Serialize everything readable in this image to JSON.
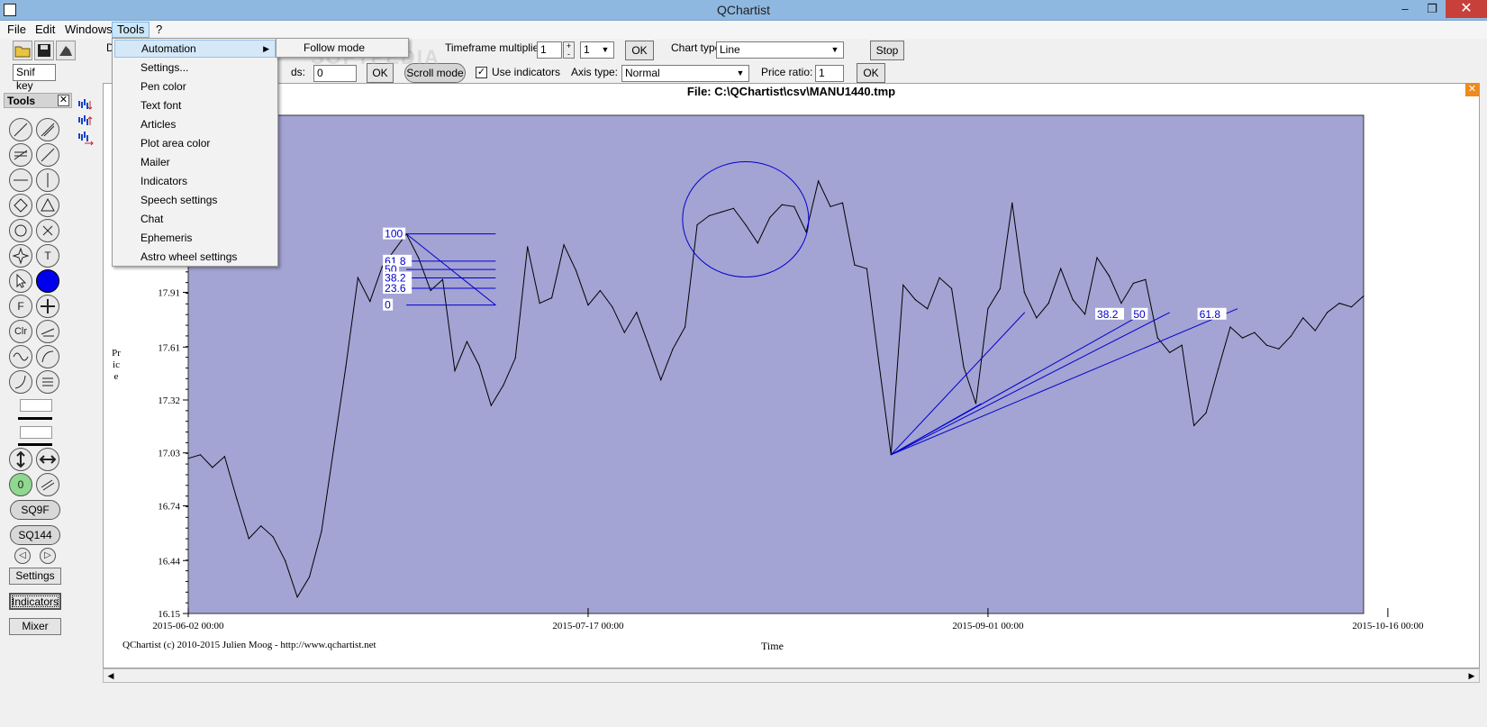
{
  "window": {
    "title": "QChartist",
    "minimize": "–",
    "maximize": "❐",
    "close": "✕"
  },
  "menubar": [
    "File",
    "Edit",
    "Windows",
    "Tools",
    "?"
  ],
  "toolbar": {
    "snif_key_value": "Snif key",
    "row1_prefix": "D",
    "row2_prefix": "0",
    "timeframe_label": "Timeframe multiplier:",
    "timeframe_value": "1",
    "stepper_plus": "+",
    "stepper_minus": "-",
    "timeframe_select": "1",
    "ok": "OK",
    "chart_type_label": "Chart type:",
    "chart_type_value": "Line",
    "stop": "Stop",
    "ds_label": "ds:",
    "ds_value": "0",
    "scroll_mode": "Scroll mode",
    "use_indicators_label": "Use indicators",
    "use_indicators_checked": "✓",
    "axis_type_label": "Axis type:",
    "axis_type_value": "Normal",
    "price_ratio_label": "Price ratio:",
    "price_ratio_value": "1"
  },
  "tools_panel": {
    "title": "Tools",
    "close": "✕",
    "labels": {
      "text": "T",
      "fib": "F",
      "clr": "Clr",
      "zero": "0"
    },
    "sq9f": "SQ9F",
    "sq144": "SQ144",
    "settings": "Settings",
    "indicators": "Indicators",
    "mixer": "Mixer"
  },
  "tools_menu": {
    "items": [
      "Automation",
      "Settings...",
      "Pen color",
      "Text font",
      "Articles",
      "Plot area color",
      "Mailer",
      "Indicators",
      "Speech settings",
      "Chat",
      "Ephemeris",
      "Astro wheel settings"
    ],
    "submenu": [
      "Follow mode"
    ]
  },
  "chart": {
    "file_title": "File: C:\\QChartist\\csv\\MANU1440.tmp",
    "copyright": "QChartist (c) 2010-2015 Julien Moog - http://www.qchartist.net",
    "watermark": "SOFTPEDIA",
    "colors": {
      "plot_bg": "#a3a3d4",
      "price_line": "#000000",
      "drawing": "#0000cc"
    },
    "fib_levels": [
      "100",
      "61.8",
      "50",
      "38.2",
      "23.6",
      "0"
    ],
    "fan_labels": [
      "38.2",
      "50",
      "61.8"
    ]
  },
  "chart_data": {
    "type": "line",
    "xlabel": "Time",
    "ylabel": "Price",
    "ylim": [
      16.15,
      18.88
    ],
    "yticks": [
      16.15,
      16.44,
      16.74,
      17.03,
      17.32,
      17.61,
      17.91
    ],
    "x_tick_labels": [
      "2015-06-02 00:00",
      "2015-07-17 00:00",
      "2015-09-01 00:00",
      "2015-10-16 00:00"
    ],
    "x_tick_index": [
      0,
      33,
      66,
      99
    ],
    "grid": false,
    "values": [
      17.0,
      17.02,
      16.95,
      17.01,
      16.78,
      16.56,
      16.63,
      16.57,
      16.44,
      16.24,
      16.35,
      16.6,
      17.05,
      17.5,
      17.99,
      17.86,
      18.05,
      18.14,
      18.23,
      18.1,
      17.92,
      17.98,
      17.48,
      17.64,
      17.51,
      17.29,
      17.4,
      17.55,
      18.16,
      17.85,
      17.88,
      18.17,
      18.03,
      17.84,
      17.92,
      17.83,
      17.69,
      17.8,
      17.62,
      17.43,
      17.6,
      17.72,
      18.28,
      18.33,
      18.35,
      18.37,
      18.28,
      18.18,
      18.32,
      18.39,
      18.38,
      18.24,
      18.52,
      18.38,
      18.4,
      18.06,
      18.04,
      17.52,
      17.02,
      17.95,
      17.87,
      17.82,
      17.99,
      17.93,
      17.5,
      17.3,
      17.82,
      17.93,
      18.4,
      17.91,
      17.77,
      17.85,
      18.04,
      17.87,
      17.79,
      18.1,
      18.0,
      17.85,
      17.96,
      17.98,
      17.66,
      17.58,
      17.62,
      17.18,
      17.25,
      17.49,
      17.72,
      17.66,
      17.69,
      17.62,
      17.6,
      17.67,
      17.77,
      17.7,
      17.8,
      17.85,
      17.83,
      17.89
    ]
  }
}
